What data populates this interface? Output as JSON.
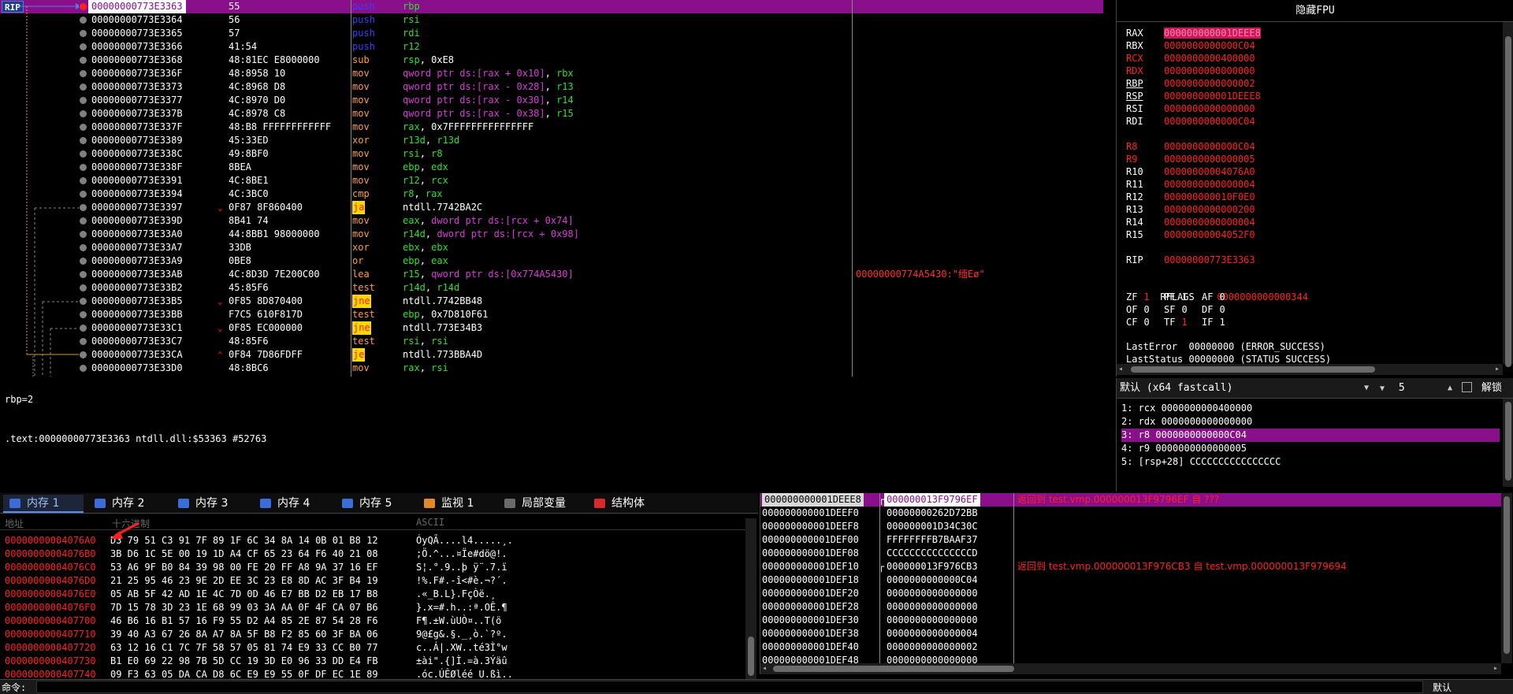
{
  "disasm": {
    "rip_label": "RIP",
    "rows": [
      {
        "addr": "00000000773E3363",
        "bytes": "55",
        "mnem": "push",
        "mcls": "m-push",
        "ops": [
          [
            "rbp",
            "o-reg"
          ]
        ],
        "bp": "red",
        "sel": true
      },
      {
        "addr": "00000000773E3364",
        "bytes": "56",
        "mnem": "push",
        "mcls": "m-push",
        "ops": [
          [
            "rsi",
            "o-reg"
          ]
        ]
      },
      {
        "addr": "00000000773E3365",
        "bytes": "57",
        "mnem": "push",
        "mcls": "m-push",
        "ops": [
          [
            "rdi",
            "o-reg"
          ]
        ]
      },
      {
        "addr": "00000000773E3366",
        "bytes": "41:54",
        "mnem": "push",
        "mcls": "m-push",
        "ops": [
          [
            "r12",
            "o-reg"
          ]
        ]
      },
      {
        "addr": "00000000773E3368",
        "bytes": "48:81EC E8000000",
        "mnem": "sub",
        "mcls": "m-sub",
        "ops": [
          [
            "rsp",
            "o-reg"
          ],
          [
            ", 0xE8",
            "o-lbl"
          ]
        ]
      },
      {
        "addr": "00000000773E336F",
        "bytes": "48:8958 10",
        "mnem": "mov",
        "mcls": "m-mov",
        "ops": [
          [
            "qword ptr ds:[rax + 0x10]",
            "o-mem"
          ],
          [
            ", ",
            "o-lbl"
          ],
          [
            "rbx",
            "o-reg"
          ]
        ]
      },
      {
        "addr": "00000000773E3373",
        "bytes": "4C:8968 D8",
        "mnem": "mov",
        "mcls": "m-mov",
        "ops": [
          [
            "qword ptr ds:[rax - 0x28]",
            "o-mem"
          ],
          [
            ", ",
            "o-lbl"
          ],
          [
            "r13",
            "o-reg"
          ]
        ]
      },
      {
        "addr": "00000000773E3377",
        "bytes": "4C:8970 D0",
        "mnem": "mov",
        "mcls": "m-mov",
        "ops": [
          [
            "qword ptr ds:[rax - 0x30]",
            "o-mem"
          ],
          [
            ", ",
            "o-lbl"
          ],
          [
            "r14",
            "o-reg"
          ]
        ]
      },
      {
        "addr": "00000000773E337B",
        "bytes": "4C:8978 C8",
        "mnem": "mov",
        "mcls": "m-mov",
        "ops": [
          [
            "qword ptr ds:[rax - 0x38]",
            "o-mem"
          ],
          [
            ", ",
            "o-lbl"
          ],
          [
            "r15",
            "o-reg"
          ]
        ]
      },
      {
        "addr": "00000000773E337F",
        "bytes": "48:B8 FFFFFFFFFFFF",
        "mnem": "mov",
        "mcls": "m-mov",
        "ops": [
          [
            "rax",
            "o-reg"
          ],
          [
            ", 0x7FFFFFFFFFFFFFFF",
            "o-lbl"
          ]
        ]
      },
      {
        "addr": "00000000773E3389",
        "bytes": "45:33ED",
        "mnem": "xor",
        "mcls": "m-xor",
        "ops": [
          [
            "r13d",
            "o-reg"
          ],
          [
            ", ",
            "o-lbl"
          ],
          [
            "r13d",
            "o-reg"
          ]
        ]
      },
      {
        "addr": "00000000773E338C",
        "bytes": "49:8BF0",
        "mnem": "mov",
        "mcls": "m-mov",
        "ops": [
          [
            "rsi",
            "o-reg"
          ],
          [
            ", ",
            "o-lbl"
          ],
          [
            "r8",
            "o-reg"
          ]
        ]
      },
      {
        "addr": "00000000773E338F",
        "bytes": "8BEA",
        "mnem": "mov",
        "mcls": "m-mov",
        "ops": [
          [
            "ebp",
            "o-reg"
          ],
          [
            ", ",
            "o-lbl"
          ],
          [
            "edx",
            "o-reg"
          ]
        ]
      },
      {
        "addr": "00000000773E3391",
        "bytes": "4C:8BE1",
        "mnem": "mov",
        "mcls": "m-mov",
        "ops": [
          [
            "r12",
            "o-reg"
          ],
          [
            ", ",
            "o-lbl"
          ],
          [
            "rcx",
            "o-reg"
          ]
        ]
      },
      {
        "addr": "00000000773E3394",
        "bytes": "4C:3BC0",
        "mnem": "cmp",
        "mcls": "m-cmp",
        "ops": [
          [
            "r8",
            "o-reg"
          ],
          [
            ", ",
            "o-lbl"
          ],
          [
            "rax",
            "o-reg"
          ]
        ]
      },
      {
        "addr": "00000000773E3397",
        "bytes": "0F87 8F860400",
        "mnem": "ja",
        "mcls": "m-jcc",
        "ops": [
          [
            "ntdll.7742BA2C",
            "o-lbl"
          ]
        ],
        "jmp": true
      },
      {
        "addr": "00000000773E339D",
        "bytes": "8B41 74",
        "mnem": "mov",
        "mcls": "m-mov",
        "ops": [
          [
            "eax",
            "o-reg"
          ],
          [
            ", ",
            "o-lbl"
          ],
          [
            "dword ptr ds:[rcx + 0x74]",
            "o-mem"
          ]
        ]
      },
      {
        "addr": "00000000773E33A0",
        "bytes": "44:8BB1 98000000",
        "mnem": "mov",
        "mcls": "m-mov",
        "ops": [
          [
            "r14d",
            "o-reg"
          ],
          [
            ", ",
            "o-lbl"
          ],
          [
            "dword ptr ds:[rcx + 0x98]",
            "o-mem"
          ]
        ]
      },
      {
        "addr": "00000000773E33A7",
        "bytes": "33DB",
        "mnem": "xor",
        "mcls": "m-xor",
        "ops": [
          [
            "ebx",
            "o-reg"
          ],
          [
            ", ",
            "o-lbl"
          ],
          [
            "ebx",
            "o-reg"
          ]
        ]
      },
      {
        "addr": "00000000773E33A9",
        "bytes": "0BE8",
        "mnem": "or",
        "mcls": "m-or",
        "ops": [
          [
            "ebp",
            "o-reg"
          ],
          [
            ", ",
            "o-lbl"
          ],
          [
            "eax",
            "o-reg"
          ]
        ]
      },
      {
        "addr": "00000000773E33AB",
        "bytes": "4C:8D3D 7E200C00",
        "mnem": "lea",
        "mcls": "m-lea",
        "ops": [
          [
            "r15",
            "o-reg"
          ],
          [
            ", ",
            "o-lbl"
          ],
          [
            "qword ptr ds:[0x774A5430]",
            "o-mem"
          ]
        ],
        "cmt": "00000000774A5430:\"缅Eø\""
      },
      {
        "addr": "00000000773E33B2",
        "bytes": "45:85F6",
        "mnem": "test",
        "mcls": "m-test",
        "ops": [
          [
            "r14d",
            "o-reg"
          ],
          [
            ", ",
            "o-lbl"
          ],
          [
            "r14d",
            "o-reg"
          ]
        ]
      },
      {
        "addr": "00000000773E33B5",
        "bytes": "0F85 8D870400",
        "mnem": "jne",
        "mcls": "m-jcc",
        "ops": [
          [
            "ntdll.7742BB48",
            "o-lbl"
          ]
        ],
        "jmp": true
      },
      {
        "addr": "00000000773E33BB",
        "bytes": "F7C5 610F817D",
        "mnem": "test",
        "mcls": "m-test",
        "ops": [
          [
            "ebp",
            "o-reg"
          ],
          [
            ", 0x7D810F61",
            "o-lbl"
          ]
        ]
      },
      {
        "addr": "00000000773E33C1",
        "bytes": "0F85 EC000000",
        "mnem": "jne",
        "mcls": "m-jcc",
        "ops": [
          [
            "ntdll.773E34B3",
            "o-lbl"
          ]
        ],
        "jmp": true
      },
      {
        "addr": "00000000773E33C7",
        "bytes": "48:85F6",
        "mnem": "test",
        "mcls": "m-test",
        "ops": [
          [
            "rsi",
            "o-reg"
          ],
          [
            ", ",
            "o-lbl"
          ],
          [
            "rsi",
            "o-reg"
          ]
        ]
      },
      {
        "addr": "00000000773E33CA",
        "bytes": "0F84 7D86FDFF",
        "mnem": "je",
        "mcls": "m-jcc",
        "ops": [
          [
            "ntdll.773BBA4D",
            "o-lbl"
          ]
        ],
        "jmp": true,
        "up": true
      },
      {
        "addr": "00000000773E33D0",
        "bytes": "48:8BC6",
        "mnem": "mov",
        "mcls": "m-mov",
        "ops": [
          [
            "rax",
            "o-reg"
          ],
          [
            ", ",
            "o-lbl"
          ],
          [
            "rsi",
            "o-reg"
          ]
        ]
      }
    ]
  },
  "info": {
    "line1": "rbp=2",
    "line2": ".text:00000000773E3363 ntdll.dll:$53363 #52763"
  },
  "regs": {
    "title": "隐藏FPU",
    "list": [
      {
        "n": "RAX",
        "v": "000000000001DEEE8",
        "hl": true
      },
      {
        "n": "RBX",
        "v": "0000000000000C04"
      },
      {
        "n": "RCX",
        "v": "0000000000400000",
        "red": true
      },
      {
        "n": "RDX",
        "v": "0000000000000000",
        "red": true
      },
      {
        "n": "RBP",
        "v": "0000000000000002",
        "u": true
      },
      {
        "n": "RSP",
        "v": "000000000001DEEE8",
        "u": true
      },
      {
        "n": "RSI",
        "v": "0000000000000000"
      },
      {
        "n": "RDI",
        "v": "0000000000000C04"
      },
      {
        "n": "",
        "v": ""
      },
      {
        "n": "R8",
        "v": "0000000000000C04",
        "red": true
      },
      {
        "n": "R9",
        "v": "0000000000000005",
        "red": true
      },
      {
        "n": "R10",
        "v": "00000000004076A0"
      },
      {
        "n": "R11",
        "v": "0000000000000004"
      },
      {
        "n": "R12",
        "v": "000000000010F0E0"
      },
      {
        "n": "R13",
        "v": "0000000000000200"
      },
      {
        "n": "R14",
        "v": "0000000000000004"
      },
      {
        "n": "R15",
        "v": "00000000004052F0"
      },
      {
        "n": "",
        "v": ""
      },
      {
        "n": "RIP",
        "v": "00000000773E3363"
      }
    ],
    "rflags_label": "RFLAGS",
    "rflags_value": "0000000000000344",
    "flags": [
      [
        [
          "ZF",
          "1",
          true
        ],
        [
          "PF",
          "1",
          false
        ],
        [
          "AF",
          "0",
          false
        ]
      ],
      [
        [
          "OF",
          "0",
          false
        ],
        [
          "SF",
          "0",
          false
        ],
        [
          "DF",
          "0",
          false
        ]
      ],
      [
        [
          "CF",
          "0",
          false
        ],
        [
          "TF",
          "1",
          true
        ],
        [
          "IF",
          "1",
          false
        ]
      ]
    ],
    "last_error": "LastError  00000000 (ERROR_SUCCESS)",
    "last_status": "LastStatus 00000000 (STATUS_SUCCESS)"
  },
  "cc": {
    "convention": "默认 (x64 fastcall)",
    "count": "5",
    "unlock": "解锁",
    "items": [
      "1: rcx 0000000000400000",
      "2: rdx 0000000000000000",
      "3: r8 0000000000000C04",
      "4: r9 0000000000000005",
      "5: [rsp+28] CCCCCCCCCCCCCCCC"
    ],
    "selected": 2
  },
  "tabs": [
    {
      "label": "内存 1",
      "icon": "#3d6bd8",
      "active": true
    },
    {
      "label": "内存 2",
      "icon": "#3d6bd8"
    },
    {
      "label": "内存 3",
      "icon": "#3d6bd8"
    },
    {
      "label": "内存 4",
      "icon": "#3d6bd8"
    },
    {
      "label": "内存 5",
      "icon": "#3d6bd8"
    },
    {
      "label": "监视 1",
      "icon": "#e08a2a"
    },
    {
      "label": "局部变量",
      "icon": "#6a6a6a"
    },
    {
      "label": "结构体",
      "icon": "#d82a2a"
    }
  ],
  "dump": {
    "col_addr": "地址",
    "col_hex": "十六进制",
    "col_ascii": "ASCII",
    "rows": [
      {
        "a": "00000000004076A0",
        "h": "D3 79 51 C3 91 7F 89 1F 6C 34 8A 14 0B 01 B8 12",
        "s": "ÓyQÃ....l4.....¸."
      },
      {
        "a": "00000000004076B0",
        "h": "3B D6 1C 5E 00 19 1D A4 CF 65 23 64 F6 40 21 08",
        "s": ";Ö.^...¤Ïe#dö@!."
      },
      {
        "a": "00000000004076C0",
        "h": "53 A6 9F B0 84 39 98 00 FE 20 FF A8 9A 37 16 EF",
        "s": "S¦.°.9..þ ÿ¨.7.ï"
      },
      {
        "a": "00000000004076D0",
        "h": "21 25 95 46 23 9E 2D EE 3C 23 E8 8D AC 3F B4 19",
        "s": "!%.F#.-î<#è.¬?´."
      },
      {
        "a": "00000000004076E0",
        "h": "05 AB 5F 42 AD 1E 4C 7D 0D 46 E7 BB D2 EB 17 B8",
        "s": ".«_B­.L}.FçÒë.¸"
      },
      {
        "a": "00000000004076F0",
        "h": "7D 15 78 3D 23 1E 68 99 03 3A AA 0F 4F CA 07 B6",
        "s": "}.x=#.h..:ª.OÊ.¶"
      },
      {
        "a": "0000000000407700",
        "h": "46 B6 16 B1 57 16 F9 55 D2 A4 85 2E 87 54 28 F6",
        "s": "F¶.±W.ùUÒ¤..T(ö"
      },
      {
        "a": "0000000000407710",
        "h": "39 40 A3 67 26 8A A7 8A 5F B8 F2 85 60 3F BA 06",
        "s": "9@£g&.§._¸ò.`?º."
      },
      {
        "a": "0000000000407720",
        "h": "63 12 16 C1 7C 7F 58 57 05 81 74 E9 33 CC B0 77",
        "s": "c..Á|.XW..té3Ì°w"
      },
      {
        "a": "0000000000407730",
        "h": "B1 E0 69 22 98 7B 5D CC 19 3D E0 96 33 DD E4 FB",
        "s": "±ài\".{]Ì.=à.3Ýäû"
      },
      {
        "a": "0000000000407740",
        "h": "09 F3 63 05 DA CA D8 6C E9 E9 55 0F DF EC 1E 89",
        "s": ".óc.ÚÊØléé U.ßì.."
      }
    ]
  },
  "stack": {
    "rows": [
      {
        "a": "000000000001DEEE8",
        "v": "000000013F9796EF",
        "c": "返回到 test.vmp.000000013F9796EF 自 ???",
        "sel": true,
        "cur": true,
        "m": true
      },
      {
        "a": "000000000001DEEF0",
        "v": "00000000262D72BB",
        "c": ""
      },
      {
        "a": "000000000001DEEF8",
        "v": "000000001D34C30C",
        "c": ""
      },
      {
        "a": "000000000001DEF00",
        "v": "FFFFFFFFB7BAAF37",
        "c": ""
      },
      {
        "a": "000000000001DEF08",
        "v": "CCCCCCCCCCCCCCCD",
        "c": ""
      },
      {
        "a": "000000000001DEF10",
        "v": "000000013F976CB3",
        "c": "返回到 test.vmp.000000013F976CB3 自 test.vmp.000000013F979694",
        "m": true
      },
      {
        "a": "000000000001DEF18",
        "v": "0000000000000C04",
        "c": ""
      },
      {
        "a": "000000000001DEF20",
        "v": "0000000000000000",
        "c": ""
      },
      {
        "a": "000000000001DEF28",
        "v": "0000000000000000",
        "c": ""
      },
      {
        "a": "000000000001DEF30",
        "v": "0000000000000000",
        "c": ""
      },
      {
        "a": "000000000001DEF38",
        "v": "0000000000000004",
        "c": ""
      },
      {
        "a": "000000000001DEF40",
        "v": "0000000000000002",
        "c": ""
      },
      {
        "a": "000000000001DEF48",
        "v": "0000000000000000",
        "c": ""
      }
    ]
  },
  "cmd": {
    "label": "命令:",
    "right": "默认"
  }
}
